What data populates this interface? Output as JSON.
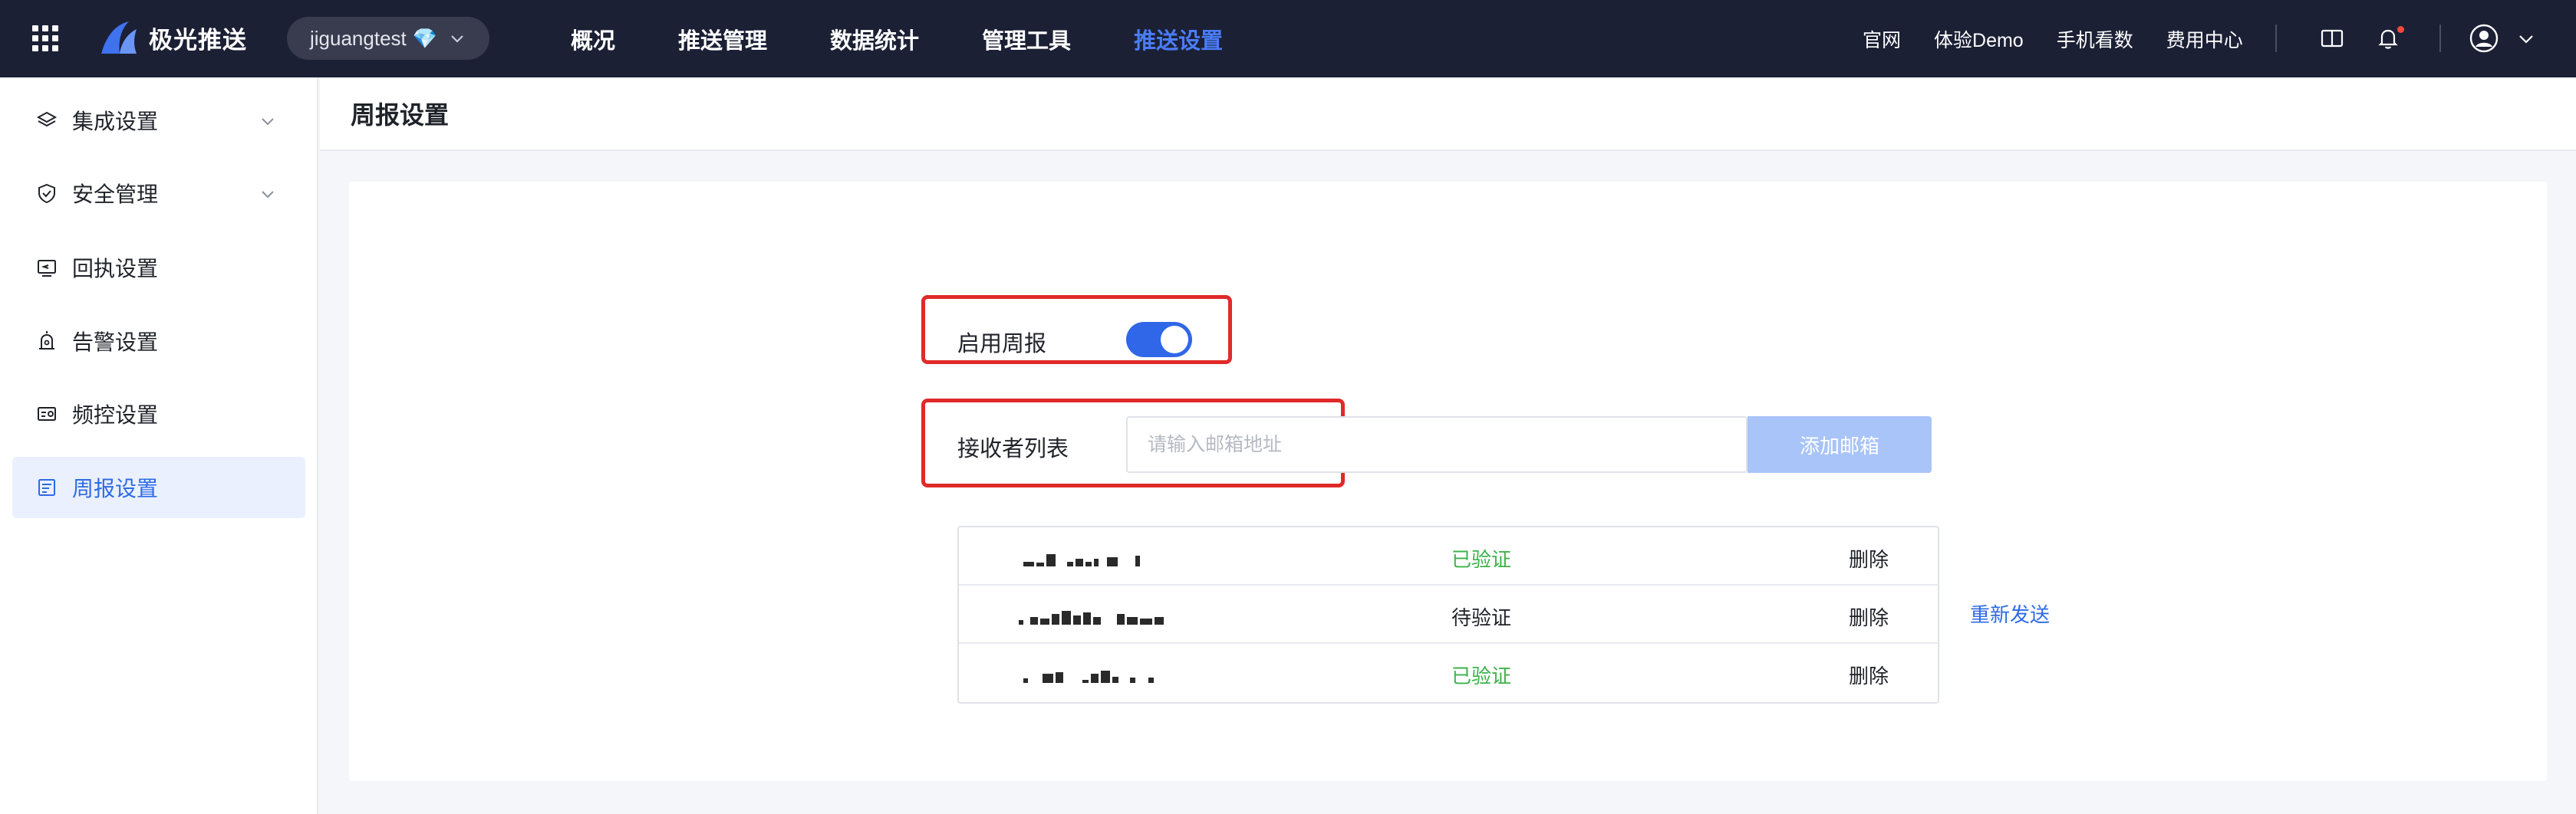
{
  "header": {
    "logo_text": "极光推送",
    "app_name": "jiguangtest",
    "app_badge": "💎",
    "nav": [
      {
        "label": "概况",
        "active": false
      },
      {
        "label": "推送管理",
        "active": false
      },
      {
        "label": "数据统计",
        "active": false
      },
      {
        "label": "管理工具",
        "active": false
      },
      {
        "label": "推送设置",
        "active": true
      }
    ],
    "links": [
      "官网",
      "体验Demo",
      "手机看数",
      "费用中心"
    ],
    "icons": [
      "book-icon",
      "bell-icon",
      "user-icon",
      "chevron-down-icon"
    ]
  },
  "sidebar": {
    "items": [
      {
        "label": "集成设置",
        "icon": "layers-icon",
        "expandable": true,
        "active": false
      },
      {
        "label": "安全管理",
        "icon": "shield-icon",
        "expandable": true,
        "active": false
      },
      {
        "label": "回执设置",
        "icon": "receipt-icon",
        "expandable": false,
        "active": false
      },
      {
        "label": "告警设置",
        "icon": "alarm-icon",
        "expandable": false,
        "active": false
      },
      {
        "label": "频控设置",
        "icon": "frequency-icon",
        "expandable": false,
        "active": false
      },
      {
        "label": "周报设置",
        "icon": "report-icon",
        "expandable": false,
        "active": true
      }
    ]
  },
  "page": {
    "title": "周报设置",
    "enable_label": "启用周报",
    "enable_on": true,
    "recipients_label": "接收者列表",
    "email_placeholder": "请输入邮箱地址",
    "email_value": "",
    "add_button": "添加邮箱",
    "recipients": [
      {
        "email_masked": true,
        "status": "已验证",
        "status_type": "verified",
        "delete": "删除",
        "resend": ""
      },
      {
        "email_masked": true,
        "status": "待验证",
        "status_type": "pending",
        "delete": "删除",
        "resend": "重新发送"
      },
      {
        "email_masked": true,
        "status": "已验证",
        "status_type": "verified",
        "delete": "删除",
        "resend": ""
      }
    ]
  },
  "colors": {
    "topbar_bg": "#1b2035",
    "accent": "#2f67e8",
    "verified": "#3cb34b",
    "highlight_box": "#e02a2a",
    "add_button_bg": "#a8c4f8"
  }
}
